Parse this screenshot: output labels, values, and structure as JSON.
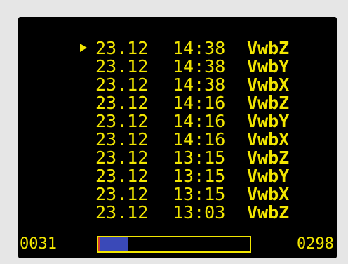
{
  "colors": {
    "text": "#f2e600",
    "screen_bg": "#000000",
    "bezel": "#e6e6e6",
    "progress_fill": "#3a49b8",
    "progress_marker": "#d23a3a"
  },
  "list": {
    "selected_index": 0,
    "cursor_icon": "triangle-right-icon",
    "items": [
      {
        "date": "23.12",
        "time": "14:38",
        "code": "VwbZ"
      },
      {
        "date": "23.12",
        "time": "14:38",
        "code": "VwbY"
      },
      {
        "date": "23.12",
        "time": "14:38",
        "code": "VwbX"
      },
      {
        "date": "23.12",
        "time": "14:16",
        "code": "VwbZ"
      },
      {
        "date": "23.12",
        "time": "14:16",
        "code": "VwbY"
      },
      {
        "date": "23.12",
        "time": "14:16",
        "code": "VwbX"
      },
      {
        "date": "23.12",
        "time": "13:15",
        "code": "VwbZ"
      },
      {
        "date": "23.12",
        "time": "13:15",
        "code": "VwbY"
      },
      {
        "date": "23.12",
        "time": "13:15",
        "code": "VwbX"
      },
      {
        "date": "23.12",
        "time": "13:03",
        "code": "VwbZ"
      }
    ]
  },
  "footer": {
    "left_counter": "0031",
    "right_counter": "0298",
    "progress_fraction": 0.2
  }
}
